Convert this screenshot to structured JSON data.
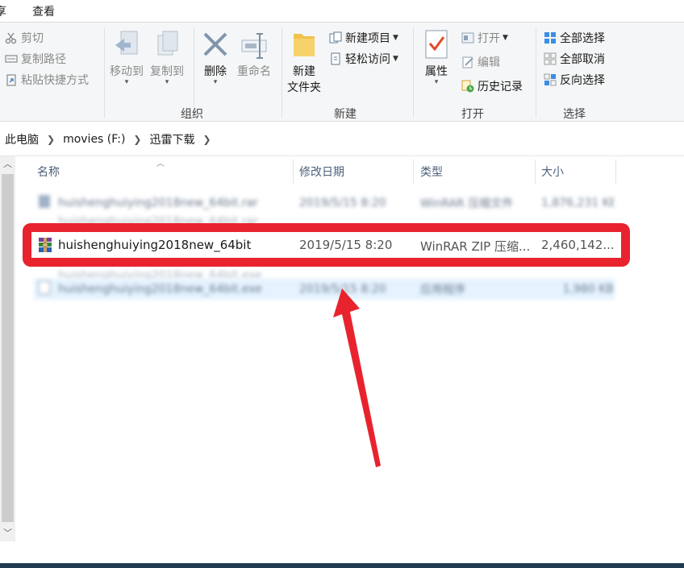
{
  "tabs": {
    "share": "享",
    "view": "查看"
  },
  "ribbon": {
    "clipboard": {
      "cut": "剪切",
      "copy_path": "复制路径",
      "paste_shortcut": "粘贴快捷方式"
    },
    "organize": {
      "move_to": "移动到",
      "copy_to": "复制到",
      "delete": "删除",
      "rename": "重命名",
      "label": "组织"
    },
    "new": {
      "new_folder_line1": "新建",
      "new_folder_line2": "文件夹",
      "new_item": "新建项目",
      "easy_access": "轻松访问",
      "label": "新建"
    },
    "open": {
      "properties": "属性",
      "open": "打开",
      "edit": "编辑",
      "history": "历史记录",
      "label": "打开"
    },
    "select": {
      "select_all": "全部选择",
      "select_none": "全部取消",
      "invert": "反向选择",
      "label": "选择"
    }
  },
  "breadcrumb": [
    "此电脑",
    "movies (F:)",
    "迅雷下载"
  ],
  "columns": {
    "name": "名称",
    "date": "修改日期",
    "type": "类型",
    "size": "大小"
  },
  "files": [
    {
      "name": "huishenghuiying2018new_64bit.rar",
      "date": "2019/5/15 8:20",
      "type": "WinRAR 压缩文件",
      "size": "1,876,231 KB"
    },
    {
      "name": "huishenghuiying2018new_64bit",
      "date": "2019/5/15 8:20",
      "type": "WinRAR ZIP 压缩...",
      "size": "2,460,142..."
    },
    {
      "name": "huishenghuiying2018new_64bit.exe",
      "date": "2019/5/15 8:20",
      "type": "应用程序",
      "size": "1,980 KB"
    }
  ],
  "highlighted_file": {
    "name": "huishenghuiying2018new_64bit",
    "date": "2019/5/15 8:20",
    "type": "WinRAR ZIP 压缩...",
    "size": "2,460,142..."
  },
  "colors": {
    "highlight": "#e8232e",
    "selection": "#e5f3ff",
    "header_text": "#4c607a"
  }
}
